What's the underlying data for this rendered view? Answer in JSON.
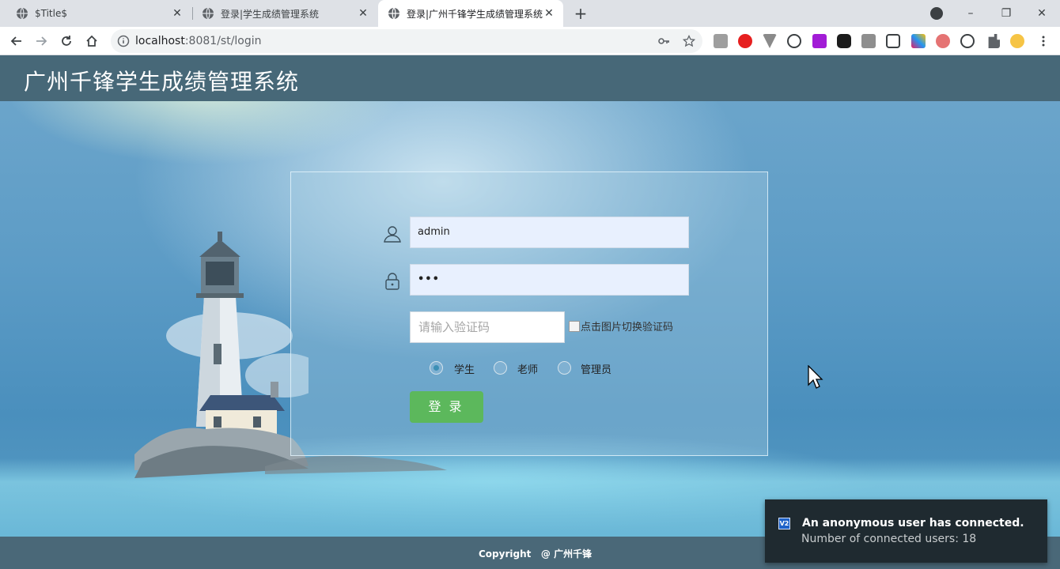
{
  "browser": {
    "tabs": [
      {
        "title": "$Title$",
        "active": false
      },
      {
        "title": "登录|学生成绩管理系统",
        "active": false
      },
      {
        "title": "登录|广州千锋学生成绩管理系统",
        "active": true
      }
    ],
    "new_tab_label": "+",
    "window_controls": {
      "minimize": "–",
      "restore": "❐",
      "close": "✕"
    },
    "tab_close_glyph": "✕",
    "url_host": "localhost",
    "url_rest": ":8081/st/login"
  },
  "site": {
    "header_title": "广州千锋学生成绩管理系统",
    "footer": "Copyright   @ 广州千锋"
  },
  "login": {
    "username_value": "admin",
    "password_value": "•••",
    "captcha_placeholder": "请输入验证码",
    "captcha_image_alt": "点击图片切换验证码",
    "roles": [
      {
        "label": "学生",
        "checked": true
      },
      {
        "label": "老师",
        "checked": false
      },
      {
        "label": "管理员",
        "checked": false
      }
    ],
    "submit_label": "登录"
  },
  "notification": {
    "app_badge": "V2",
    "title": "An anonymous user has connected.",
    "body": "Number of connected users: 18"
  },
  "colors": {
    "header_bg": "#476878",
    "footer_bg": "#4a6878",
    "button_bg": "#5cb85c",
    "field_bg": "#e8f0fe",
    "toast_bg": "#1f2a30"
  }
}
